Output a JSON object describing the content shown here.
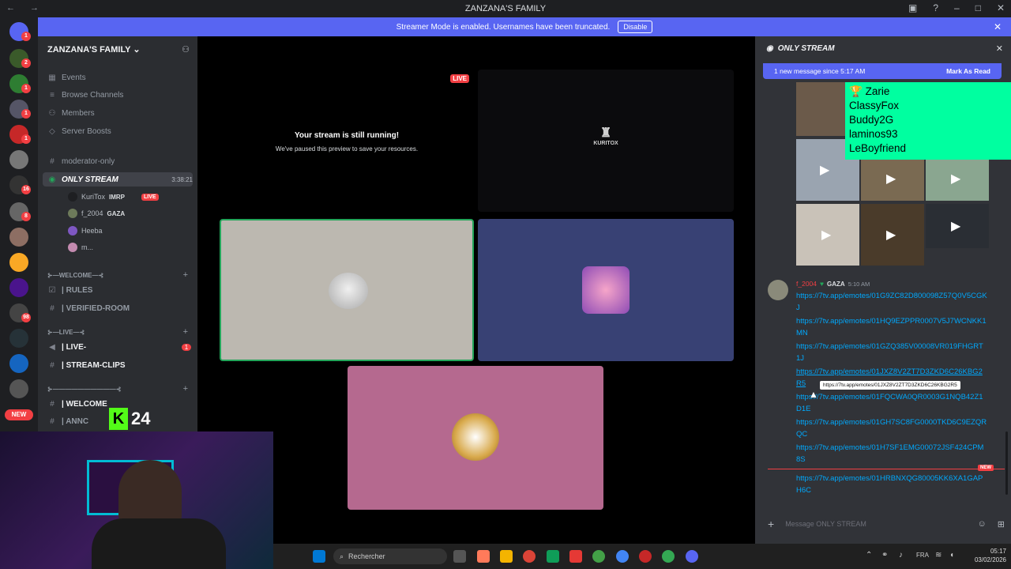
{
  "window": {
    "title": "ZANZANA'S FAMILY",
    "nav": "← →"
  },
  "banner": {
    "text": "Streamer Mode is enabled. Usernames have been truncated.",
    "button": "Disable"
  },
  "rail": {
    "new_badge": "NEW",
    "badges": [
      "1",
      "2",
      "1",
      "1",
      "1",
      "4",
      "1",
      "16",
      "8",
      "2",
      "1",
      "1",
      "98",
      "1",
      "2",
      "1"
    ]
  },
  "sidebar": {
    "server_name": "ZANZANA'S FAMILY",
    "items": [
      "Events",
      "Browse Channels",
      "Members",
      "Server Boosts"
    ],
    "channels": {
      "moderator": "moderator-only",
      "stream": "ONLY STREAM",
      "stream_time": "3:38:21",
      "welcome_cat": "⊱—WELCOME—⊰",
      "rules": "| RULES",
      "verified": "| VERIFIED-ROOM",
      "live_cat": "⊱—LIVE—⊰",
      "live": "| LIVE-",
      "live_count": "1",
      "clips": "| STREAM-CLIPS",
      "cat3": "⊱——————————⊰",
      "welcome2": "| WELCOME",
      "annc": "| ANNC"
    },
    "users": [
      {
        "name": "KuriTox",
        "role": "IMRP",
        "live": "LIVE"
      },
      {
        "name": "f_2004",
        "role": "GAZA"
      },
      {
        "name": "Heeba"
      },
      {
        "name": "m..."
      }
    ]
  },
  "stage": {
    "live_badge": "LIVE",
    "paused_title": "Your stream is still running!",
    "paused_sub": "We've paused this preview to save your resources.",
    "logo_text": "KURITOX"
  },
  "overlay": {
    "brand": "24"
  },
  "chat": {
    "title": "ONLY STREAM",
    "new_msgs": "1 new message since 5:17 AM",
    "mark_read": "Mark As Read",
    "overlay_names": [
      "Zarie",
      "ClassyFox",
      "Buddy2G",
      "laminos93",
      "LeBoyfriend"
    ],
    "author": "f_2004",
    "author_role": "GAZA",
    "time": "5:10 AM",
    "links": [
      "https://7tv.app/emotes/01G9ZC82D800098Z57Q0V5CGKJ",
      "https://7tv.app/emotes/01HQ9EZPPR0007V5J7WCNKK1MN",
      "https://7tv.app/emotes/01GZQ385V00008VR019FHGRT1J",
      "https://7tv.app/emotes/01JXZ8V2ZT7D3ZKD6C26KBG2R5",
      "https://7tv.app/emotes/01FQCWA0QR0003G1NQB42Z1D1E",
      "https://7tv.app/emotes/01GH7SC8FG0000TKD6C9EZQRQC",
      "https://7tv.app/emotes/01H7SF1EMG00072JSF424CPM8S"
    ],
    "tooltip": "https://7tv.app/emotes/01JXZ8V2ZT7D3ZKD6C26KBG2R5",
    "new_label": "NEW",
    "last_link": "https://7tv.app/emotes/01HRBNXQG80005KK6XA1GAPH6C",
    "placeholder": "Message ONLY STREAM"
  },
  "taskbar": {
    "search": "Rechercher",
    "lang": "FRA",
    "time": "05:17",
    "date": "03/02/2026"
  },
  "colors": {
    "blurple": "#5865f2",
    "green": "#23a55a",
    "red": "#f23f43",
    "link": "#00a8fc"
  }
}
